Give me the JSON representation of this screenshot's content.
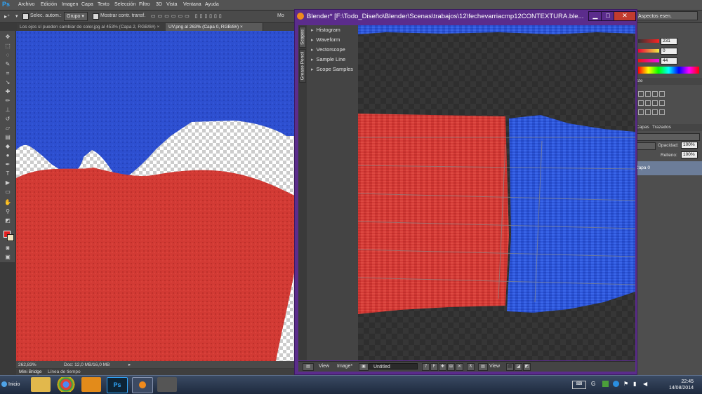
{
  "photoshop": {
    "logo": "Ps",
    "menu": [
      "Archivo",
      "Edición",
      "Imagen",
      "Capa",
      "Texto",
      "Selección",
      "Filtro",
      "3D",
      "Vista",
      "Ventana",
      "Ayuda"
    ],
    "options": {
      "auto_select_label": "Selec. autom.:",
      "group_value": "Grupo",
      "show_transform_label": "Mostrar contr. transf."
    },
    "workspace": "Aspectos esen.",
    "tabs": [
      {
        "label": "Los ojos sí pueden cambiar de color.jpg al 453% (Capa 2, RGB/8#)"
      },
      {
        "label": "UV.png al 263% (Capa 0, RGB/8#)"
      }
    ],
    "status": {
      "zoom": "262,83%",
      "doc": "Doc: 12,0 MB/16,0 MB"
    },
    "bottom_tabs": [
      "Mini Bridge",
      "Línea de tiempo"
    ],
    "color_panel": {
      "values": [
        "231",
        "0",
        "44"
      ]
    },
    "layers_panel": {
      "tab1": "Capas",
      "tab2": "Trazados",
      "opacity_label": "Opacidad:",
      "opacity_value": "100%",
      "fill_label": "Relleno:",
      "fill_value": "100%",
      "layer_name": "Capa 0"
    },
    "colors": {
      "red": "#d23a34",
      "blue": "#2d4fd0",
      "foreground": "#e0201f"
    }
  },
  "blender": {
    "title": "Blender* [F:\\Todo_Diseño\\Blender\\Scenas\\trabajos\\12\\fechevarriacmp12CONTEXTURA.ble...",
    "side_tabs": [
      "Scopes",
      "Grease Pencil"
    ],
    "scopes": [
      "Histogram",
      "Waveform",
      "Vectorscope",
      "Sample Line",
      "Scope Samples"
    ],
    "header": {
      "view": "View",
      "image": "Image*",
      "image_name": "Untitled",
      "users": "7",
      "fake_user": "F",
      "view2": "View"
    },
    "colors": {
      "titlebar": "#5b2c8c",
      "close": "#c23b2e"
    }
  },
  "taskbar": {
    "start": "Inicio",
    "apps": [
      "explorer",
      "chrome",
      "media-player",
      "photoshop",
      "blender",
      "usb-drive"
    ],
    "time": "22:45",
    "date": "14/08/2014"
  }
}
